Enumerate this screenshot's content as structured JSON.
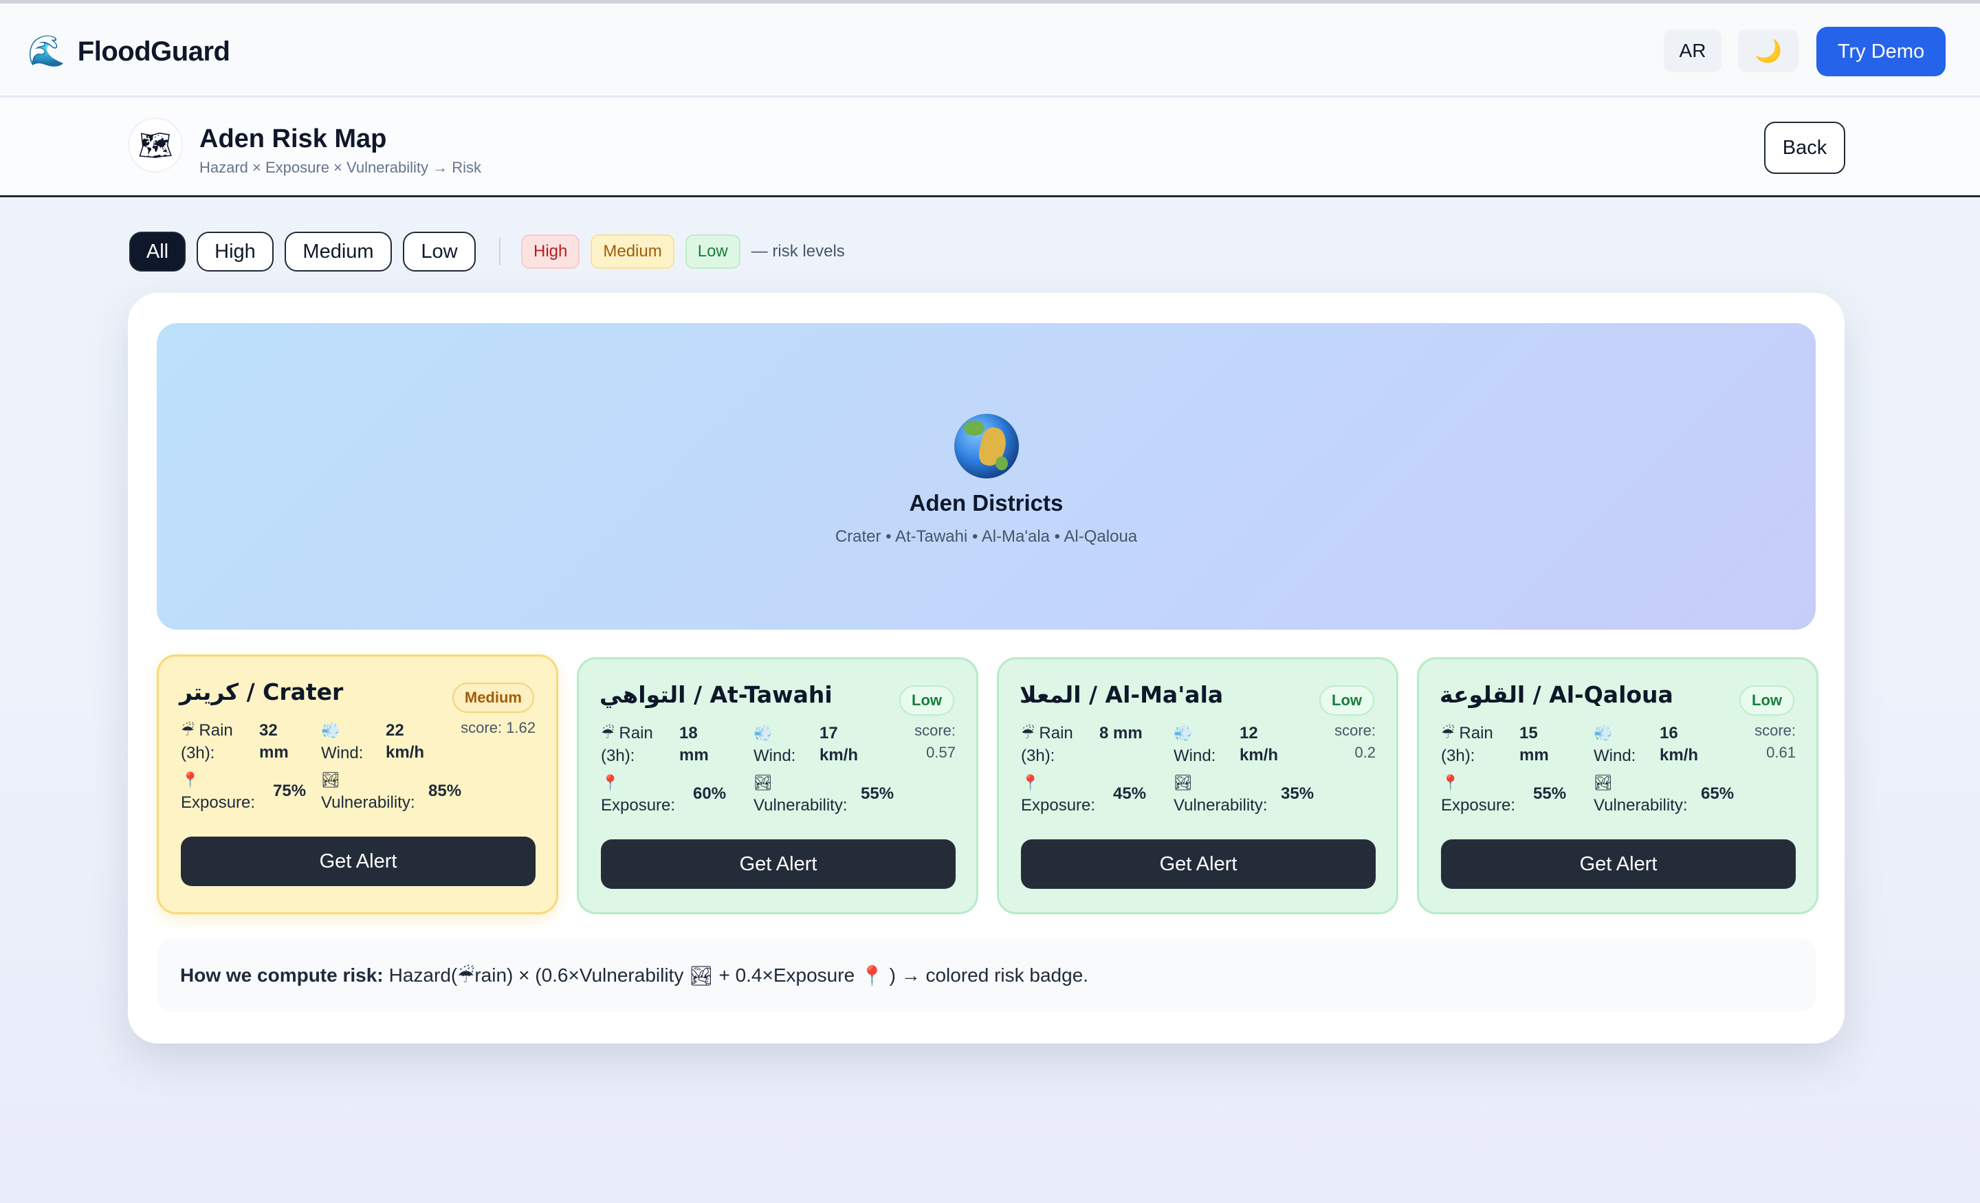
{
  "app": {
    "brand_icon": "🌊",
    "brand_name": "FloodGuard",
    "lang_label": "AR",
    "theme_icon": "🌙",
    "demo_label": "Try Demo"
  },
  "header": {
    "map_icon": "🗺",
    "title": "Aden Risk Map",
    "subtitle": "Hazard × Exposure × Vulnerability → Risk",
    "back_label": "Back"
  },
  "filters": {
    "options": [
      "All",
      "High",
      "Medium",
      "Low"
    ],
    "selected": "All",
    "legend": [
      "High",
      "Medium",
      "Low"
    ],
    "legend_note": "— risk levels"
  },
  "hero": {
    "icon": "globe-africa",
    "title": "Aden Districts",
    "subtitle": "Crater • At-Tawahi • Al-Ma'ala • Al-Qaloua"
  },
  "labels": {
    "rain_icon": "☔",
    "rain_label": "Rain (3h):",
    "wind_icon": "💨",
    "wind_label": "Wind:",
    "exposure_icon": "📍",
    "exposure_label": "Exposure:",
    "vulnerability_icon": "🏞",
    "vulnerability_label": "Vulnerability:",
    "alert_button": "Get Alert"
  },
  "districts": [
    {
      "name": "كريتر / Crater",
      "level": "Medium",
      "score": "score: 1.62",
      "rain": "32 mm",
      "wind": "22 km/h",
      "exposure": "75%",
      "vulnerability": "85%"
    },
    {
      "name": "التواهي / At-Tawahi",
      "level": "Low",
      "score": "score: 0.57",
      "rain": "18 mm",
      "wind": "17 km/h",
      "exposure": "60%",
      "vulnerability": "55%"
    },
    {
      "name": "المعلا / Al-Ma'ala",
      "level": "Low",
      "score": "score: 0.2",
      "rain": "8 mm",
      "wind": "12 km/h",
      "exposure": "45%",
      "vulnerability": "35%"
    },
    {
      "name": "القلوعة / Al-Qaloua",
      "level": "Low",
      "score": "score: 0.61",
      "rain": "15 mm",
      "wind": "16 km/h",
      "exposure": "55%",
      "vulnerability": "65%"
    }
  ],
  "formula": {
    "label": "How we compute risk:",
    "part1": "Hazard(",
    "rain_emoji": "☔",
    "part2": "rain) × (0.6×Vulnerability",
    "vuln_emoji": "🏞",
    "part3": "+ 0.4×Exposure",
    "pin_emoji": "📍",
    "part4": ") → colored risk badge."
  },
  "colors": {
    "primary": "#2563eb",
    "dark": "#252c39",
    "medium_bg": "#fdf3c4",
    "low_bg": "#ddf6e5",
    "high_badge": "#b91c1c"
  }
}
